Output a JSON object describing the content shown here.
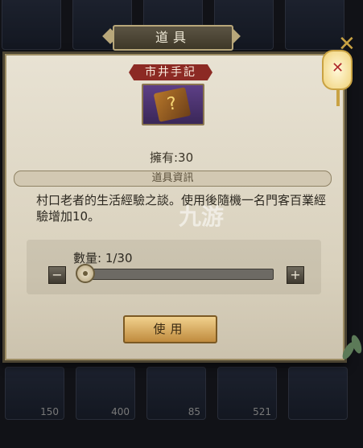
{
  "dialog": {
    "title": "道具",
    "item_name": "市井手記",
    "item_icon": "book-icon",
    "owned": "擁有:30",
    "section_title": "道具資訊",
    "description": "村口老者的生活經驗之談。使用後隨機一名門客百業經驗增加10。",
    "quantity": {
      "label": "數量: 1/30",
      "current": 1,
      "max": 30
    },
    "decrease_label": "−",
    "increase_label": "+",
    "use_label": "使用",
    "close_label": "✕",
    "watermark": "九游"
  },
  "background_inventory": {
    "counts": [
      "150",
      "400",
      "85",
      "521"
    ]
  },
  "colors": {
    "accent": "#8c2a24",
    "button": "#d9a95a",
    "panel": "#e3dccb"
  }
}
